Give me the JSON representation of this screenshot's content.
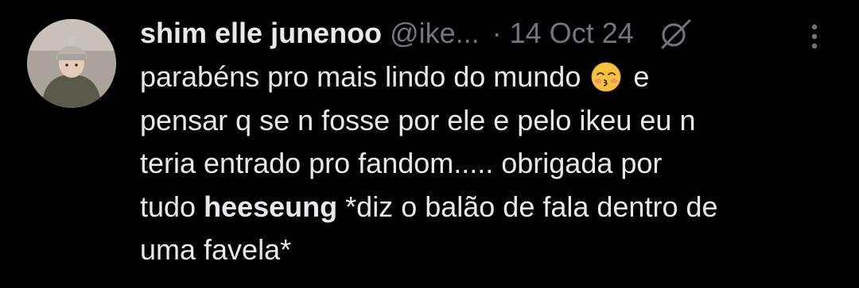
{
  "author": {
    "display_name": "shim elle junenoo",
    "handle": "@ike...",
    "separator": "·",
    "date": "14 Oct 24"
  },
  "icons": {
    "avatar": "profile-photo-child-in-knit-hat",
    "status": "slashed-circle-icon",
    "more": "vertical-ellipsis-icon",
    "emoji": "kissing-face-with-closed-eyes-emoji"
  },
  "tweet": {
    "line1": "parabéns pro mais lindo do mundo",
    "line1_after_emoji": "e",
    "line2": "pensar q se n fosse por ele e pelo ikeu eu n",
    "line3": "teria entrado pro fandom..... obrigada por",
    "line4_before": "tudo",
    "line4_bold": "heeseung",
    "line4_after": "*diz o balão de fala dentro de",
    "line5": "uma favela*"
  },
  "colors": {
    "background": "#000000",
    "text_primary": "#e7e9ea",
    "text_secondary": "#71767b",
    "avatar_ring": "#6b2c86"
  }
}
